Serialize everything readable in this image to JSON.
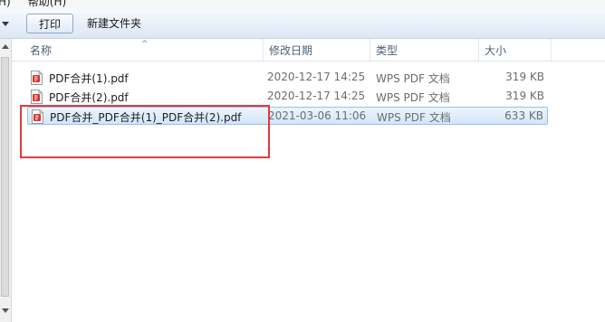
{
  "menubar": {
    "text": "H)     帮助(H)"
  },
  "toolbar": {
    "print_label": "打印",
    "new_folder_label": "新建文件夹"
  },
  "columns": {
    "name": "名称",
    "date": "修改日期",
    "type": "类型",
    "size": "大小"
  },
  "files": [
    {
      "name": "PDF合并(1).pdf",
      "date": "2020-12-17 14:25",
      "type": "WPS PDF 文档",
      "size": "319 KB"
    },
    {
      "name": "PDF合并(2).pdf",
      "date": "2020-12-17 14:25",
      "type": "WPS PDF 文档",
      "size": "319 KB"
    },
    {
      "name": "PDF合并_PDF合并(1)_PDF合并(2).pdf",
      "date": "2021-03-06 11:06",
      "type": "WPS PDF 文档",
      "size": "633 KB"
    }
  ],
  "colors": {
    "highlight_box": "#e33b3b",
    "selection": "#d3e5fa",
    "pdf_icon": "#d9342b"
  },
  "icons": {
    "file": "pdf-file-icon"
  }
}
